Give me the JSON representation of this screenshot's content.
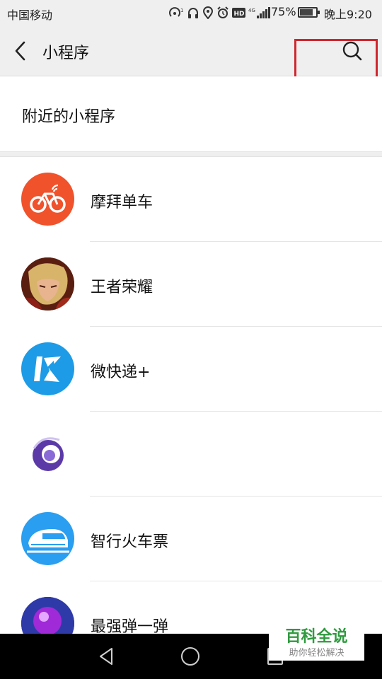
{
  "status_bar": {
    "carrier": "中国移动",
    "battery_percent": "75%",
    "time": "晚上9:20",
    "network": "4G",
    "icons": [
      "hotspot-icon",
      "headphone-icon",
      "location-icon",
      "alarm-icon",
      "hd-icon",
      "signal-icon",
      "battery-icon"
    ]
  },
  "nav": {
    "title": "小程序",
    "back_icon": "chevron-left-icon",
    "search_icon": "search-icon",
    "highlight_color": "#d0262d"
  },
  "nearby": {
    "label": "附近的小程序"
  },
  "apps": [
    {
      "name": "摩拜单车",
      "icon": "mobike-icon",
      "color": "#f0522b"
    },
    {
      "name": "王者荣耀",
      "icon": "honor-of-kings-icon",
      "color": "#8a3a1a"
    },
    {
      "name": "微快递+",
      "icon": "express-icon",
      "color": "#1d9be6"
    },
    {
      "name": "",
      "icon": "swirl-icon",
      "color": "#5b3aa8"
    },
    {
      "name": "智行火车票",
      "icon": "train-icon",
      "color": "#2a9ef0"
    },
    {
      "name": "最强弹一弹",
      "icon": "bounce-ball-icon",
      "color": "#6a2bc4"
    }
  ],
  "watermark": {
    "title": "百科全说",
    "subtitle": "助你轻松解决",
    "color": "#2f9a3f"
  }
}
